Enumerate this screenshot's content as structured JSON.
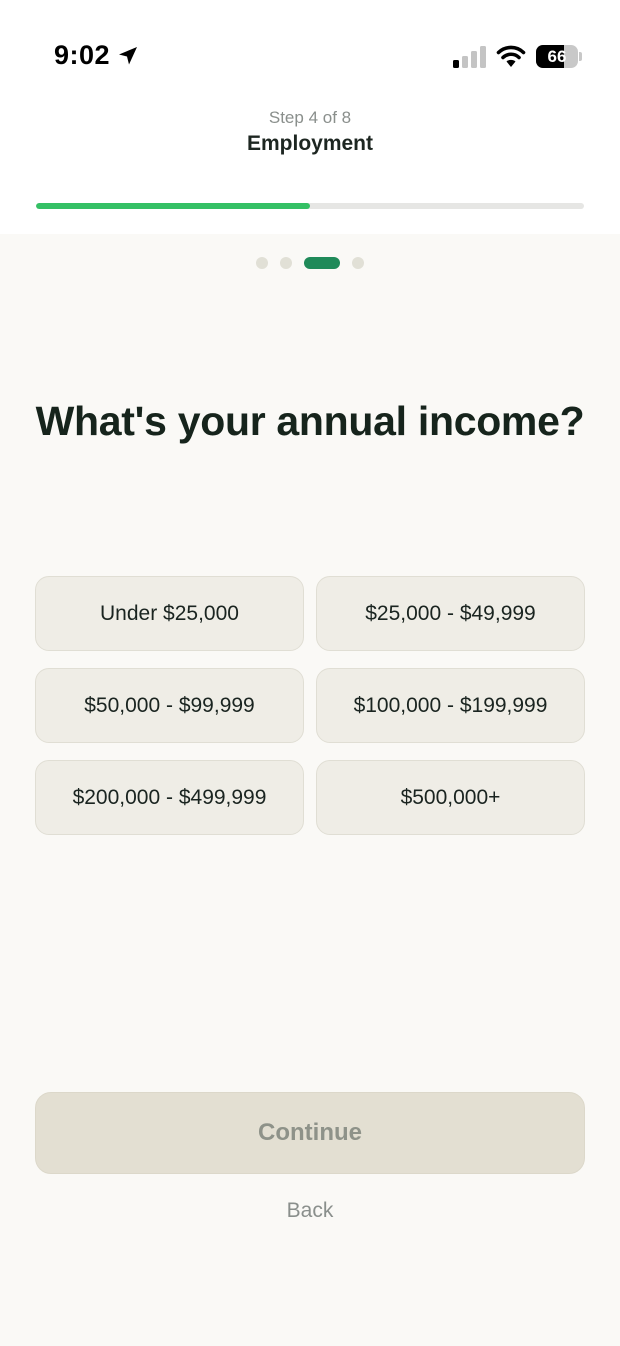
{
  "status_bar": {
    "time": "9:02",
    "battery_level": "66",
    "battery_fraction": 0.66,
    "icons": [
      "location-arrow-icon",
      "signal-icon",
      "wifi-icon",
      "battery-icon"
    ]
  },
  "header": {
    "step_label": "Step 4 of 8",
    "section_title": "Employment",
    "progress_fraction": 0.5
  },
  "pager": {
    "count": 4,
    "active_index": 2
  },
  "question": "What's your annual income?",
  "options": [
    {
      "label": "Under $25,000"
    },
    {
      "label": "$25,000 - $49,999"
    },
    {
      "label": "$50,000 - $99,999"
    },
    {
      "label": "$100,000 - $199,999"
    },
    {
      "label": "$200,000 - $499,999"
    },
    {
      "label": "$500,000+"
    }
  ],
  "actions": {
    "continue_label": "Continue",
    "back_label": "Back"
  },
  "colors": {
    "accent_green": "#34c065",
    "pager_active": "#1f8a59",
    "background": "#faf9f6",
    "option_bg": "#efede6",
    "continue_disabled_bg": "#e3dfd2"
  }
}
